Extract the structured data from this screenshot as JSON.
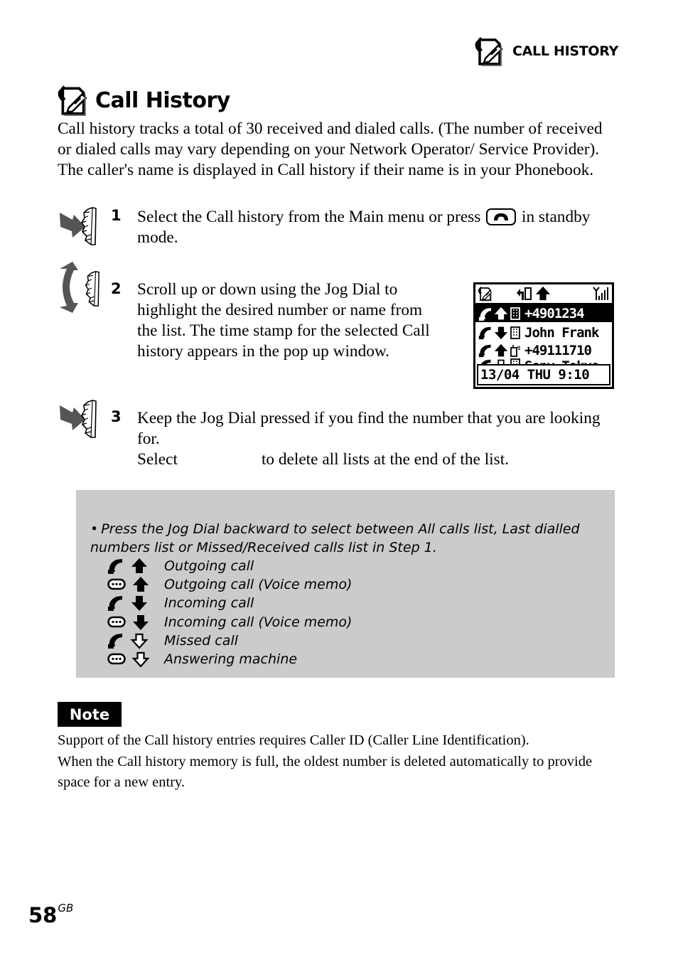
{
  "header": {
    "section_label": "CALL HISTORY",
    "icon": "call-history-icon"
  },
  "page": {
    "title": "Call History",
    "intro": "Call history tracks a total of 30 received and dialed calls. (The number of received or dialed calls may vary depending on your Network Operator/ Service Provider). The caller's name is displayed in Call history if their name is in your Phonebook."
  },
  "steps": [
    {
      "number": "1",
      "icon": "jog-dial-press-icon",
      "text_before_key": "Select the Call history from the Main menu or press",
      "key_icon": "phone-key-icon",
      "text_after_key": "in standby mode."
    },
    {
      "number": "2",
      "icon": "jog-dial-rotate-icon",
      "text": "Scroll up or down using the Jog Dial to highlight the desired number or name from the list. The time stamp for the selected Call history appears in the pop up window."
    },
    {
      "number": "3",
      "icon": "jog-dial-press-icon",
      "line1": "Keep the Jog Dial pressed if you find the number that you are looking for.",
      "line2_before": "Select",
      "line2_after": "to delete all lists at the end of the list."
    }
  ],
  "lcd": {
    "rows": [
      {
        "direction": "outgoing",
        "entry_type": "office",
        "text": "+4901234",
        "selected": true
      },
      {
        "direction": "incoming",
        "entry_type": "office",
        "text": "John Frank",
        "selected": false
      },
      {
        "direction": "outgoing",
        "entry_type": "mobile",
        "text": "+49111710",
        "selected": false
      },
      {
        "direction": "missed",
        "entry_type": "office",
        "text": "Sony Tokyo",
        "selected": false
      }
    ],
    "popup": "13/04 THU  9:10"
  },
  "tip": {
    "bullet": "•",
    "text": "Press the Jog Dial backward to select between All calls list, Last dialled numbers list or Missed/Received calls list in Step 1.",
    "legend": [
      {
        "type_icon": "handset",
        "direction_icon": "arrow-up-filled",
        "label": "Outgoing call"
      },
      {
        "type_icon": "voice-memo",
        "direction_icon": "arrow-up-filled",
        "label": "Outgoing call (Voice memo)"
      },
      {
        "type_icon": "handset",
        "direction_icon": "arrow-down-filled",
        "label": "Incoming call"
      },
      {
        "type_icon": "voice-memo",
        "direction_icon": "arrow-down-filled",
        "label": "Incoming call (Voice memo)"
      },
      {
        "type_icon": "handset",
        "direction_icon": "arrow-down-outline",
        "label": "Missed call"
      },
      {
        "type_icon": "voice-memo",
        "direction_icon": "arrow-down-outline",
        "label": "Answering machine"
      }
    ]
  },
  "note": {
    "badge": "Note",
    "paragraphs": [
      "Support of the Call history entries requires Caller ID (Caller Line Identification).",
      "When the Call history memory is full, the oldest number is deleted automatically to provide space for a new entry."
    ]
  },
  "footer": {
    "page_number": "58",
    "suffix": "GB"
  }
}
